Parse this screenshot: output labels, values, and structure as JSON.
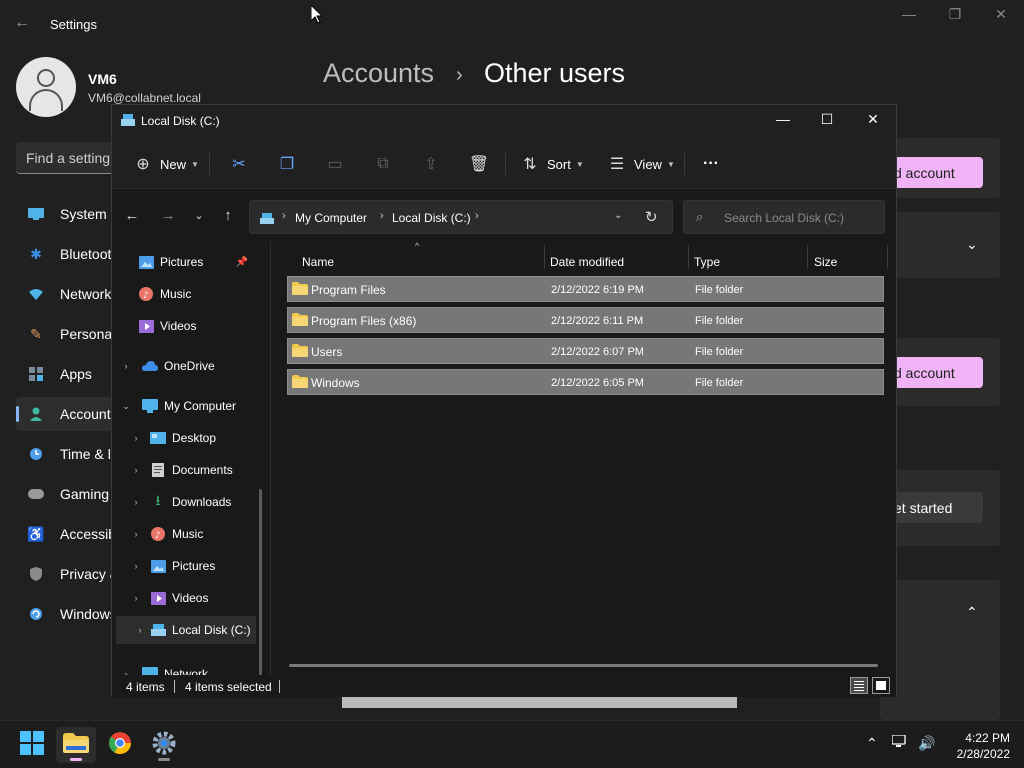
{
  "settings": {
    "window_title": "Settings",
    "user_name": "VM6",
    "user_email": "VM6@collabnet.local",
    "find_placeholder": "Find a setting",
    "breadcrumb_parent": "Accounts",
    "breadcrumb_separator": "›",
    "breadcrumb_current": "Other users",
    "nav": [
      {
        "label": "System",
        "icon": "monitor-icon"
      },
      {
        "label": "Bluetooth & devices",
        "icon": "bluetooth-icon"
      },
      {
        "label": "Network & internet",
        "icon": "wifi-icon"
      },
      {
        "label": "Personalization",
        "icon": "brush-icon"
      },
      {
        "label": "Apps",
        "icon": "apps-icon"
      },
      {
        "label": "Accounts",
        "icon": "person-icon",
        "active": true
      },
      {
        "label": "Time & language",
        "icon": "clock-icon"
      },
      {
        "label": "Gaming",
        "icon": "gamepad-icon"
      },
      {
        "label": "Accessibility",
        "icon": "accessibility-icon"
      },
      {
        "label": "Privacy & security",
        "icon": "shield-icon"
      },
      {
        "label": "Windows Update",
        "icon": "update-icon"
      }
    ],
    "add_account_1": "d account",
    "add_account_2": "d account",
    "get_started": "et started"
  },
  "explorer": {
    "title": "Local Disk (C:)",
    "toolbar": {
      "new_label": "New",
      "sort_label": "Sort",
      "view_label": "View",
      "more_label": "···"
    },
    "address": {
      "parts": [
        "My Computer",
        "Local Disk (C:)"
      ],
      "separator": "›"
    },
    "search_placeholder": "Search Local Disk (C:)",
    "nav_pane": [
      {
        "label": "Pictures",
        "icon": "pictures-icon",
        "color": "#4f9de8",
        "pinned": true
      },
      {
        "label": "Music",
        "icon": "music-icon",
        "color": "#e8746a"
      },
      {
        "label": "Videos",
        "icon": "videos-icon",
        "color": "#9b6cd8"
      },
      {
        "label": "OneDrive",
        "icon": "onedrive-icon",
        "color": "#3d8ee8",
        "chevron": "›"
      },
      {
        "label": "My Computer",
        "icon": "computer-icon",
        "color": "#4fb2e8",
        "chevron": "⌄"
      },
      {
        "label": "Desktop",
        "icon": "desktop-icon",
        "color": "#4fb2e8",
        "chevron": "›"
      },
      {
        "label": "Documents",
        "icon": "documents-icon",
        "color": "#d0d0d0",
        "chevron": "›"
      },
      {
        "label": "Downloads",
        "icon": "downloads-icon",
        "color": "#3fb86b",
        "chevron": "›"
      },
      {
        "label": "Music",
        "icon": "music-icon",
        "color": "#e8746a",
        "chevron": "›"
      },
      {
        "label": "Pictures",
        "icon": "pictures-icon",
        "color": "#4f9de8",
        "chevron": "›"
      },
      {
        "label": "Videos",
        "icon": "videos-icon",
        "color": "#9b6cd8",
        "chevron": "›"
      },
      {
        "label": "Local Disk (C:)",
        "icon": "drive-icon",
        "color": "#9ad0f0",
        "chevron": "›",
        "selected": true
      },
      {
        "label": "Network",
        "icon": "network-icon",
        "color": "#4fb2e8",
        "chevron": "›"
      }
    ],
    "columns": [
      "Name",
      "Date modified",
      "Type",
      "Size"
    ],
    "files": [
      {
        "name": "Program Files",
        "date": "2/12/2022 6:19 PM",
        "type": "File folder"
      },
      {
        "name": "Program Files (x86)",
        "date": "2/12/2022 6:11 PM",
        "type": "File folder"
      },
      {
        "name": "Users",
        "date": "2/12/2022 6:07 PM",
        "type": "File folder"
      },
      {
        "name": "Windows",
        "date": "2/12/2022 6:05 PM",
        "type": "File folder"
      }
    ],
    "status": {
      "items": "4 items",
      "selected": "4 items selected"
    }
  },
  "taskbar": {
    "time": "4:22 PM",
    "date": "2/28/2022"
  },
  "colors": {
    "accent_pink": "#f0b3f5",
    "folder_yellow": "#f2c94c",
    "selection_row": "#777777"
  }
}
